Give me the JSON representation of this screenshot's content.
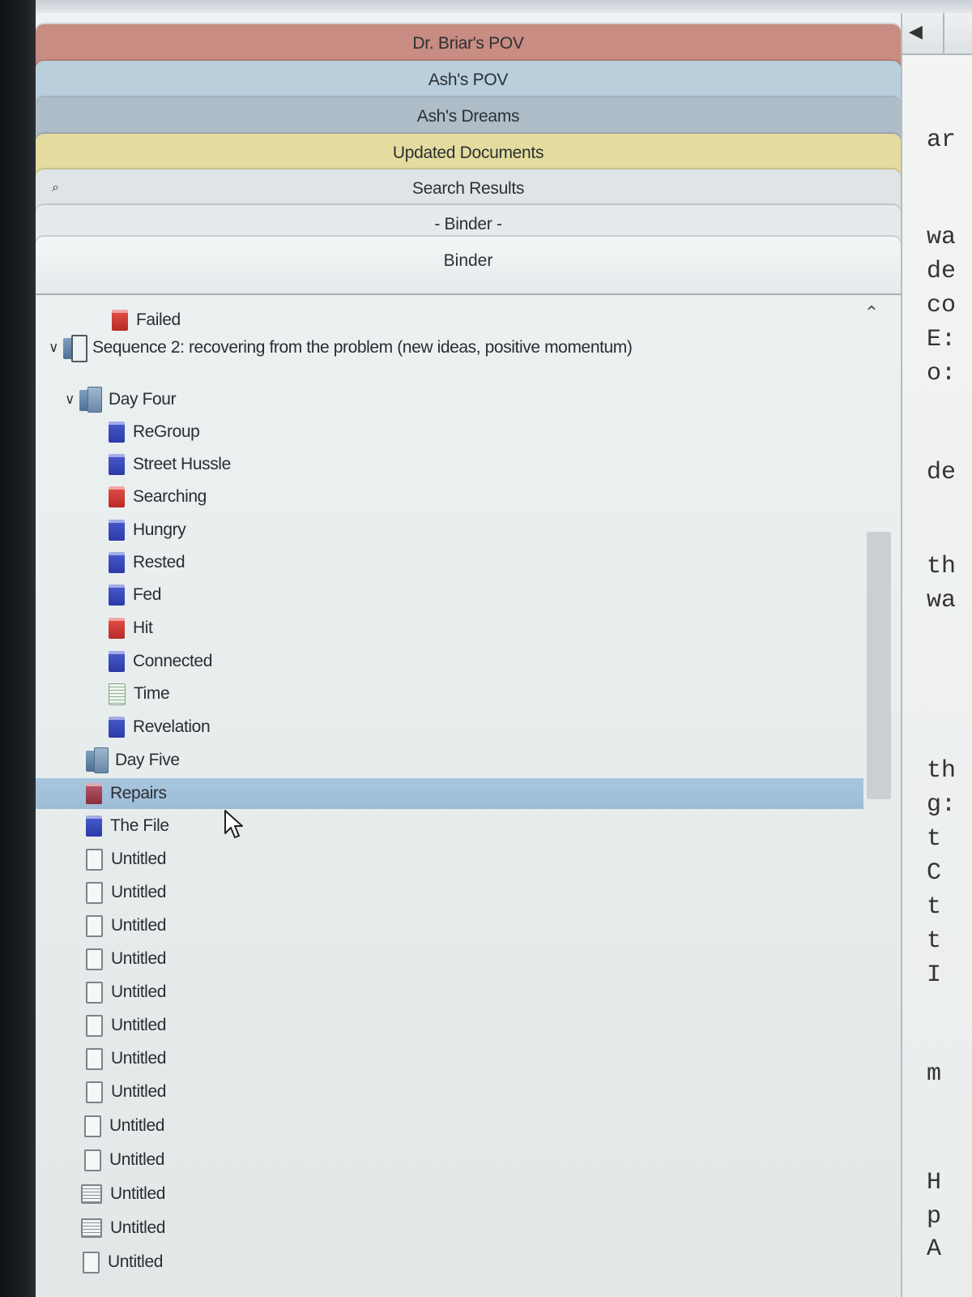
{
  "collections": [
    {
      "label": "Dr. Briar's POV",
      "color": "#c98c82"
    },
    {
      "label": "Ash's POV",
      "color": "#b9cfdc"
    },
    {
      "label": "Ash's Dreams",
      "color": "#aebdc8"
    },
    {
      "label": "Updated Documents",
      "color": "#e4dc9e"
    },
    {
      "label": "Search Results",
      "color": "#dfe4e7",
      "icon": "magnifier-icon"
    },
    {
      "label": "- Binder -",
      "color": "#e6eaec"
    }
  ],
  "binder": {
    "title": "Binder",
    "items": [
      {
        "label": "Failed",
        "icon": "red"
      },
      {
        "label": "Sequence 2: recovering from the problem (new ideas, positive momentum)",
        "icon": "folder-pages",
        "expanded": true
      },
      {
        "label": "Day Four",
        "icon": "folder",
        "expanded": true
      },
      {
        "label": "ReGroup",
        "icon": "blue"
      },
      {
        "label": "Street Hussle",
        "icon": "blue"
      },
      {
        "label": "Searching",
        "icon": "red"
      },
      {
        "label": "Hungry",
        "icon": "blue"
      },
      {
        "label": "Rested",
        "icon": "blue"
      },
      {
        "label": "Fed",
        "icon": "blue"
      },
      {
        "label": "Hit",
        "icon": "red"
      },
      {
        "label": "Connected",
        "icon": "blue"
      },
      {
        "label": "Time",
        "icon": "text-green"
      },
      {
        "label": "Revelation",
        "icon": "blue"
      },
      {
        "label": "Day Five",
        "icon": "folder"
      },
      {
        "label": "Repairs",
        "icon": "maroon",
        "selected": true
      },
      {
        "label": "The File",
        "icon": "blue"
      },
      {
        "label": "Untitled",
        "icon": "empty"
      },
      {
        "label": "Untitled",
        "icon": "empty"
      },
      {
        "label": "Untitled",
        "icon": "empty"
      },
      {
        "label": "Untitled",
        "icon": "empty"
      },
      {
        "label": "Untitled",
        "icon": "empty"
      },
      {
        "label": "Untitled",
        "icon": "empty"
      },
      {
        "label": "Untitled",
        "icon": "empty"
      },
      {
        "label": "Untitled",
        "icon": "empty"
      },
      {
        "label": "Untitled",
        "icon": "empty"
      },
      {
        "label": "Untitled",
        "icon": "empty"
      },
      {
        "label": "Untitled",
        "icon": "lined"
      },
      {
        "label": "Untitled",
        "icon": "lined"
      },
      {
        "label": "Untitled",
        "icon": "empty"
      }
    ]
  },
  "editor": {
    "visible_fragments": [
      "ar",
      "wa",
      "de",
      "co",
      "E:",
      "o:",
      "de",
      "th",
      "wa",
      "th",
      "g:",
      "t",
      "C",
      "t",
      "t",
      "I",
      "m",
      "H",
      "p",
      "A"
    ]
  }
}
